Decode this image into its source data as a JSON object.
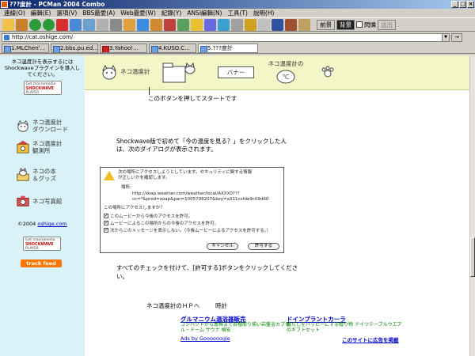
{
  "window": {
    "title": "???度計 - PCMan 2004 Combo",
    "controls": [
      "_",
      "□",
      "×"
    ]
  },
  "menu": [
    "連線(O)",
    "編輯(E)",
    "選項(V)",
    "BBS最愛(A)",
    "Web最愛(W)",
    "紀錄(Y)",
    "ANSI編輯(N)",
    "工具(T)",
    "說明(H)"
  ],
  "toolbar": {
    "front_label": "前景",
    "back_label": "背景",
    "flash_label": "閃爍",
    "send_label": "送出"
  },
  "address": {
    "url": "http://cat.oshige.com/",
    "go_label": "→"
  },
  "tabs": [
    {
      "label": "1.MLChen'..."
    },
    {
      "label": "2.bbs.pu.ed..."
    },
    {
      "label": "3.Yahoo!..."
    },
    {
      "label": "4.KUSO.C..."
    },
    {
      "label": "5.???度計"
    }
  ],
  "sidebar": {
    "note": "ネコ温度計を表示するにはShockwaveプラグインを導入してください。",
    "badge_top_small": "Get macromedia",
    "badge_top_brand": "SHOCKWAVE",
    "badge_top_player": "PLAYER",
    "items": [
      {
        "label_a": "ネコ温度計",
        "label_b": "ダウンロード",
        "icon": "cat-icon"
      },
      {
        "label_a": "ネコ温度計",
        "label_b": "観測所",
        "icon": "observatory-icon"
      },
      {
        "label_a": "ネコの本",
        "label_b": "＆グッズ",
        "icon": "book-icon"
      },
      {
        "label_a": "ネコ写真館",
        "label_b": "",
        "icon": "camera-icon"
      }
    ],
    "copyright": "©2004",
    "copyright_link": "oshige.com",
    "badge_bottom_small": "Get macromedia",
    "badge_bottom_brand": "SHOCKWAVE",
    "badge_bottom_player": "PLAYER",
    "trackfeed": "track feed"
  },
  "header": {
    "nav": [
      {
        "label": "ネコ温度計",
        "icon": "cat-icon"
      },
      {
        "label": "",
        "icon": "folder-icon"
      },
      {
        "label": "バナー",
        "icon": "banner-icon"
      },
      {
        "label": "ネコ温度計の",
        "icon": "clock-icon"
      },
      {
        "label": "",
        "icon": "pawprint-icon"
      }
    ]
  },
  "content": {
    "start_caption": "このボタンを押してスタートです",
    "shockwave_p1": "Shockwave版で初めて「今の温度を見る？」をクリックした人",
    "shockwave_p2": "は、次のダイアログが表示されます。",
    "check_p1": "すべてのチェックを付けて、[許可する]ボタンをクリックしてくださ",
    "check_p2": "い。",
    "hp_caption": "ネコ温度計のＨＰへ",
    "time_caption": "時計"
  },
  "dialog": {
    "warn_line1": "次の場所にアクセスしようとしています。セキュリティに関する情報",
    "warn_line2": "が正しいかを確認します。",
    "field_label": "場所:",
    "url1": "http://xoap.weather.com/weather/local/AXXX0???",
    "url2": "cc=*&prod=xoap&par=1005708207&key=a311ccfde9c09d60",
    "question": "この場所にアクセスしますか？",
    "opt1": "このムービーから今後のアクセスを許可。",
    "opt2": "ムービーによるこの場所からの今後のアクセスを許可。",
    "opt3": "次からこのメッセージを表示しない。（今後ムービーによるアクセスを許可する。）",
    "cancel": "キャンセル",
    "allow": "許可する"
  },
  "footer": {
    "ad1_title": "グルマニウム温浴器販売",
    "ad1_desc_1": "コンパクトから本格まで各種取り揃い岩盤浴カプセ",
    "ad1_desc_2": "ル・ドーム サウナ 格安",
    "ad2_title": "ドインプラントカーラ",
    "ad2_desc_1": "暮らしをハッピーにする贈り物 ドイツテーブルウエア",
    "ad2_desc_2": "のギフトセット",
    "ads_by": "Ads by Goooooogle",
    "advertise": "このサイトに広告を掲載"
  }
}
